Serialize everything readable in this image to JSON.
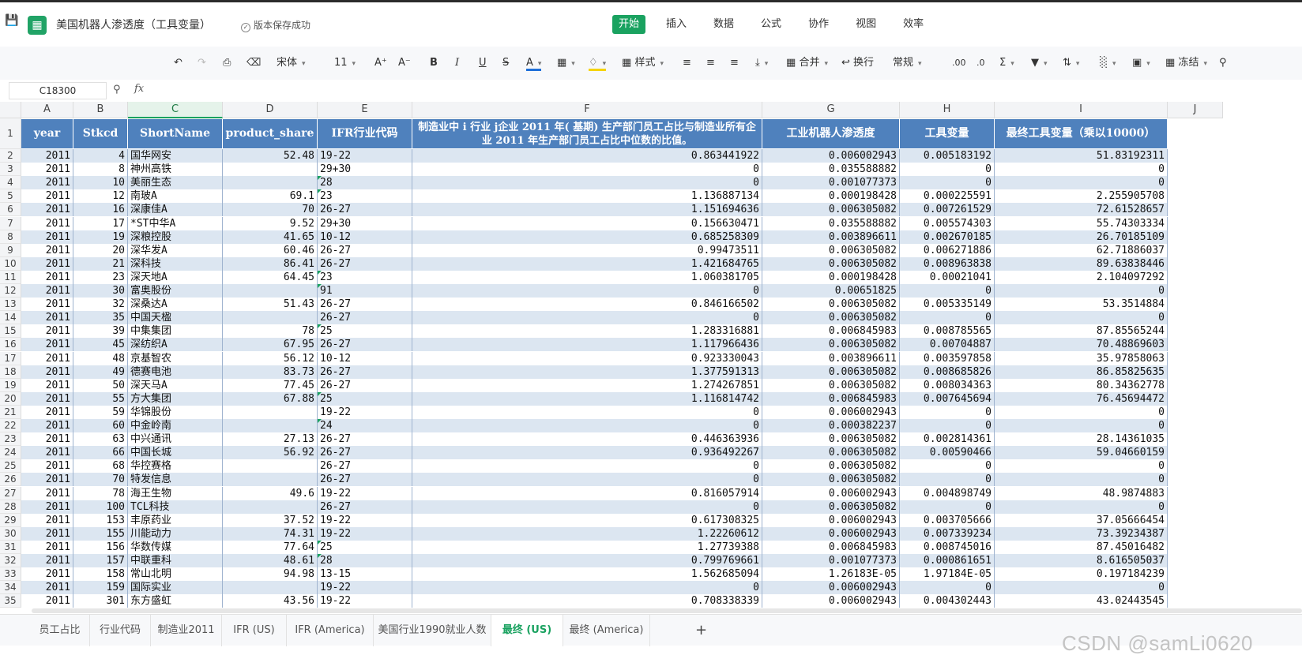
{
  "title_bar": {
    "title": "美国机器人渗透度（工具变量）",
    "save_status": "版本保存成功",
    "logo_glyph": "▦"
  },
  "menu": [
    {
      "label": "开始",
      "active": true
    },
    {
      "label": "插入",
      "active": false
    },
    {
      "label": "数据",
      "active": false
    },
    {
      "label": "公式",
      "active": false
    },
    {
      "label": "协作",
      "active": false
    },
    {
      "label": "视图",
      "active": false
    },
    {
      "label": "效率",
      "active": false
    }
  ],
  "toolbar": {
    "font_name": "宋体",
    "font_size": "11",
    "style_label": "样式",
    "merge_label": "合并",
    "wrap_label": "换行",
    "number_format": "常规",
    "freeze_label": "冻结",
    "icons": [
      "undo-icon",
      "redo-icon",
      "format-painter-icon",
      "eraser-icon",
      "increase-font-icon",
      "decrease-font-icon",
      "bold-icon",
      "italic-icon",
      "underline-icon",
      "strikethrough-icon",
      "font-color-icon",
      "border-icon",
      "fill-color-icon",
      "align-left-icon",
      "align-center-icon",
      "align-right-icon",
      "vertical-align-icon",
      "decimal-add-icon",
      "decimal-remove-icon",
      "sum-icon",
      "filter-icon",
      "sort-icon",
      "chart-icon",
      "picture-icon",
      "search-icon"
    ],
    "accent_color": "#1aa260"
  },
  "formula_bar": {
    "cell_ref": "C18300",
    "fx_label": "fx",
    "content": ""
  },
  "columns": [
    "A",
    "B",
    "C",
    "D",
    "E",
    "F",
    "G",
    "H",
    "I",
    "J"
  ],
  "header_row": {
    "row_number": "1",
    "cells": [
      "year",
      "Stkcd",
      "ShortName",
      "product_share",
      "IFR行业代码",
      "制造业中 i 行业 j企业 2011 年( 基期) 生产部门员工占比与制造业所有企业 2011 年生产部门员工占比中位数的比值。",
      "工业机器人渗透度",
      "工具变量",
      "最终工具变量（乘以10000）"
    ],
    "fill_color": "#4f81bd"
  },
  "rows": [
    {
      "n": "2",
      "c": [
        "2011",
        "4",
        "国华网安",
        "52.48",
        "19-22",
        "0.863441922",
        "0.006002943",
        "0.005183192",
        "51.83192311"
      ]
    },
    {
      "n": "3",
      "c": [
        "2011",
        "8",
        "神州高铁",
        "",
        "29+30",
        "0",
        "0.035588882",
        "0",
        "0"
      ]
    },
    {
      "n": "4",
      "c": [
        "2011",
        "10",
        "美丽生态",
        "",
        "28",
        "0",
        "0.001077373",
        "0",
        "0"
      ]
    },
    {
      "n": "5",
      "c": [
        "2011",
        "12",
        "南玻A",
        "69.1",
        "23",
        "1.136887134",
        "0.000198428",
        "0.000225591",
        "2.255905708"
      ]
    },
    {
      "n": "6",
      "c": [
        "2011",
        "16",
        "深康佳A",
        "70",
        "26-27",
        "1.151694636",
        "0.006305082",
        "0.007261529",
        "72.61528657"
      ]
    },
    {
      "n": "7",
      "c": [
        "2011",
        "17",
        "*ST中华A",
        "9.52",
        "29+30",
        "0.156630471",
        "0.035588882",
        "0.005574303",
        "55.74303334"
      ]
    },
    {
      "n": "8",
      "c": [
        "2011",
        "19",
        "深粮控股",
        "41.65",
        "10-12",
        "0.685258309",
        "0.003896611",
        "0.002670185",
        "26.70185109"
      ]
    },
    {
      "n": "9",
      "c": [
        "2011",
        "20",
        "深华发A",
        "60.46",
        "26-27",
        "0.99473511",
        "0.006305082",
        "0.006271886",
        "62.71886037"
      ]
    },
    {
      "n": "10",
      "c": [
        "2011",
        "21",
        "深科技",
        "86.41",
        "26-27",
        "1.421684765",
        "0.006305082",
        "0.008963838",
        "89.63838446"
      ]
    },
    {
      "n": "11",
      "c": [
        "2011",
        "23",
        "深天地A",
        "64.45",
        "23",
        "1.060381705",
        "0.000198428",
        "0.00021041",
        "2.104097292"
      ]
    },
    {
      "n": "12",
      "c": [
        "2011",
        "30",
        "富奥股份",
        "",
        "91",
        "0",
        "0.00651825",
        "0",
        "0"
      ]
    },
    {
      "n": "13",
      "c": [
        "2011",
        "32",
        "深桑达A",
        "51.43",
        "26-27",
        "0.846166502",
        "0.006305082",
        "0.005335149",
        "53.3514884"
      ]
    },
    {
      "n": "14",
      "c": [
        "2011",
        "35",
        "中国天楹",
        "",
        "26-27",
        "0",
        "0.006305082",
        "0",
        "0"
      ]
    },
    {
      "n": "15",
      "c": [
        "2011",
        "39",
        "中集集团",
        "78",
        "25",
        "1.283316881",
        "0.006845983",
        "0.008785565",
        "87.85565244"
      ]
    },
    {
      "n": "16",
      "c": [
        "2011",
        "45",
        "深纺织A",
        "67.95",
        "26-27",
        "1.117966436",
        "0.006305082",
        "0.00704887",
        "70.48869603"
      ]
    },
    {
      "n": "17",
      "c": [
        "2011",
        "48",
        "京基智农",
        "56.12",
        "10-12",
        "0.923330043",
        "0.003896611",
        "0.003597858",
        "35.97858063"
      ]
    },
    {
      "n": "18",
      "c": [
        "2011",
        "49",
        "德赛电池",
        "83.73",
        "26-27",
        "1.377591313",
        "0.006305082",
        "0.008685826",
        "86.85825635"
      ]
    },
    {
      "n": "19",
      "c": [
        "2011",
        "50",
        "深天马A",
        "77.45",
        "26-27",
        "1.274267851",
        "0.006305082",
        "0.008034363",
        "80.34362778"
      ]
    },
    {
      "n": "20",
      "c": [
        "2011",
        "55",
        "方大集团",
        "67.88",
        "25",
        "1.116814742",
        "0.006845983",
        "0.007645694",
        "76.45694472"
      ]
    },
    {
      "n": "21",
      "c": [
        "2011",
        "59",
        "华锦股份",
        "",
        "19-22",
        "0",
        "0.006002943",
        "0",
        "0"
      ]
    },
    {
      "n": "22",
      "c": [
        "2011",
        "60",
        "中金岭南",
        "",
        "24",
        "0",
        "0.000382237",
        "0",
        "0"
      ]
    },
    {
      "n": "23",
      "c": [
        "2011",
        "63",
        "中兴通讯",
        "27.13",
        "26-27",
        "0.446363936",
        "0.006305082",
        "0.002814361",
        "28.14361035"
      ]
    },
    {
      "n": "24",
      "c": [
        "2011",
        "66",
        "中国长城",
        "56.92",
        "26-27",
        "0.936492267",
        "0.006305082",
        "0.00590466",
        "59.04660159"
      ]
    },
    {
      "n": "25",
      "c": [
        "2011",
        "68",
        "华控赛格",
        "",
        "26-27",
        "0",
        "0.006305082",
        "0",
        "0"
      ]
    },
    {
      "n": "26",
      "c": [
        "2011",
        "70",
        "特发信息",
        "",
        "26-27",
        "0",
        "0.006305082",
        "0",
        "0"
      ]
    },
    {
      "n": "27",
      "c": [
        "2011",
        "78",
        "海王生物",
        "49.6",
        "19-22",
        "0.816057914",
        "0.006002943",
        "0.004898749",
        "48.9874883"
      ]
    },
    {
      "n": "28",
      "c": [
        "2011",
        "100",
        "TCL科技",
        "",
        "26-27",
        "0",
        "0.006305082",
        "0",
        "0"
      ]
    },
    {
      "n": "29",
      "c": [
        "2011",
        "153",
        "丰原药业",
        "37.52",
        "19-22",
        "0.617308325",
        "0.006002943",
        "0.003705666",
        "37.05666454"
      ]
    },
    {
      "n": "30",
      "c": [
        "2011",
        "155",
        "川能动力",
        "74.31",
        "19-22",
        "1.22260612",
        "0.006002943",
        "0.007339234",
        "73.39234387"
      ]
    },
    {
      "n": "31",
      "c": [
        "2011",
        "156",
        "华数传媒",
        "77.64",
        "25",
        "1.27739388",
        "0.006845983",
        "0.008745016",
        "87.45016482"
      ]
    },
    {
      "n": "32",
      "c": [
        "2011",
        "157",
        "中联重科",
        "48.61",
        "28",
        "0.799769661",
        "0.001077373",
        "0.000861651",
        "8.616505037"
      ]
    },
    {
      "n": "33",
      "c": [
        "2011",
        "158",
        "常山北明",
        "94.98",
        "13-15",
        "1.562685094",
        "1.26183E-05",
        "1.97184E-05",
        "0.197184239"
      ]
    },
    {
      "n": "34",
      "c": [
        "2011",
        "159",
        "国际实业",
        "",
        "19-22",
        "0",
        "0.006002943",
        "0",
        "0"
      ]
    },
    {
      "n": "35",
      "c": [
        "2011",
        "301",
        "东方盛虹",
        "43.56",
        "19-22",
        "0.708338339",
        "0.006002943",
        "0.004302443",
        "43.02443545"
      ]
    }
  ],
  "row_colors": {
    "even_fill": "#dce6f1",
    "odd_fill": "#ffffff",
    "grid_line": "#9fb3cf"
  },
  "sheet_tabs": [
    {
      "label": "员工占比",
      "active": false
    },
    {
      "label": "行业代码",
      "active": false
    },
    {
      "label": "制造业2011",
      "active": false
    },
    {
      "label": "IFR (US)",
      "active": false
    },
    {
      "label": "IFR (America)",
      "active": false
    },
    {
      "label": "美国行业1990就业人数",
      "active": false
    },
    {
      "label": "最终 (US)",
      "active": true
    },
    {
      "label": "最终 (America)",
      "active": false
    }
  ],
  "add_sheet_label": "+",
  "watermark": "CSDN @samLi0620"
}
